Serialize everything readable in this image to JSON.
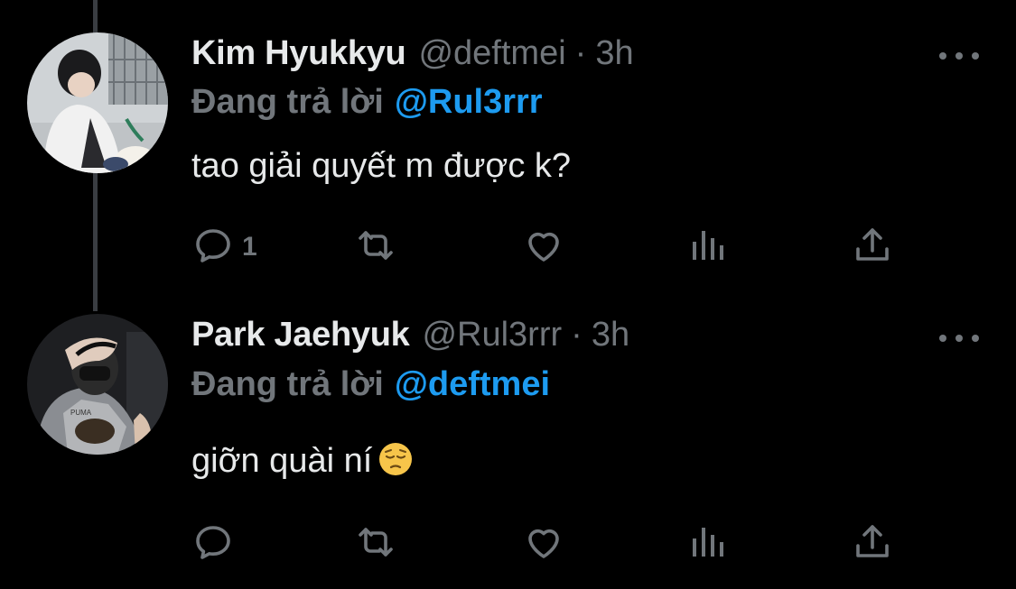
{
  "colors": {
    "background": "#000000",
    "text": "#e7e9ea",
    "muted": "#71767b",
    "link": "#1d9bf0",
    "thread_line": "#3a3d42"
  },
  "tweets": [
    {
      "display_name": "Kim Hyukkyu",
      "handle": "@deftmei",
      "separator": "·",
      "time": "3h",
      "reply_prefix": "Đang trả lời",
      "reply_handle": "@Rul3rrr",
      "text": "tao giải quyết m được k?",
      "emoji": "",
      "reply_count": "1",
      "icons": [
        "reply-icon",
        "retweet-icon",
        "like-icon",
        "analytics-icon",
        "share-icon",
        "more-icon"
      ]
    },
    {
      "display_name": "Park Jaehyuk",
      "handle": "@Rul3rrr",
      "separator": "·",
      "time": "3h",
      "reply_prefix": "Đang trả lời",
      "reply_handle": "@deftmei",
      "text": "giỡn quài ní",
      "emoji": "pensive-face-emoji",
      "reply_count": "",
      "icons": [
        "reply-icon",
        "retweet-icon",
        "like-icon",
        "analytics-icon",
        "share-icon",
        "more-icon"
      ]
    }
  ]
}
